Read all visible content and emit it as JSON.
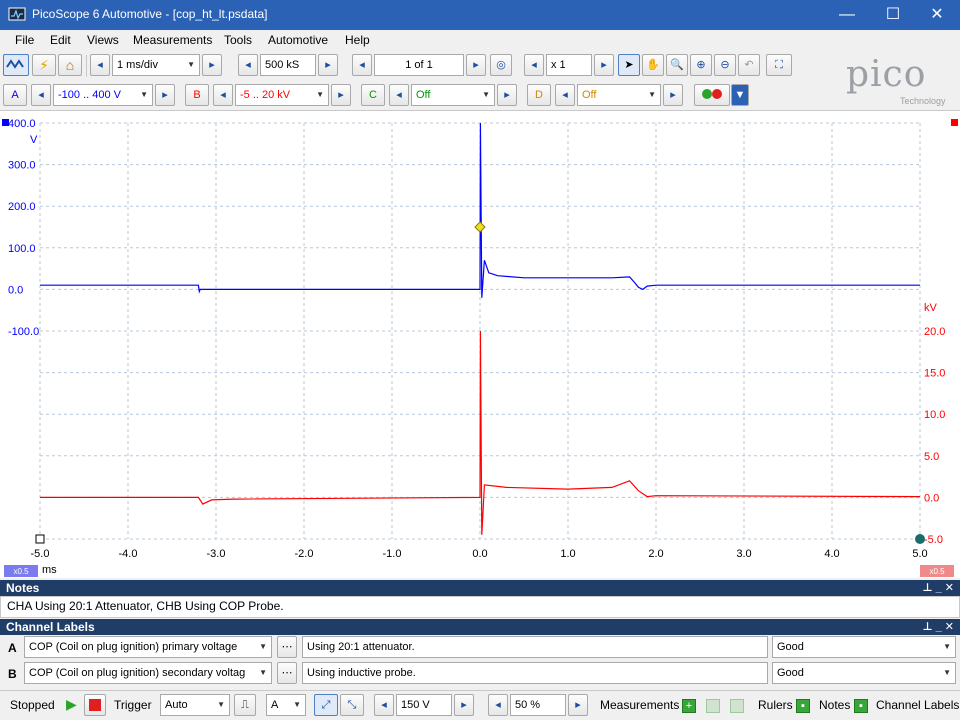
{
  "window": {
    "title": "PicoScope 6 Automotive - [cop_ht_lt.psdata]",
    "minimize": "—",
    "maximize": "☐",
    "close": "✕"
  },
  "menu": [
    "File",
    "Edit",
    "Views",
    "Measurements",
    "Tools",
    "Automotive",
    "Help"
  ],
  "toolbar": {
    "timebase": "1 ms/div",
    "samples": "500 kS",
    "buffer": "1 of 1",
    "zoom": "x 1"
  },
  "channels": {
    "a": {
      "letter": "A",
      "range": "-100 .. 400 V",
      "color": "#0000ff"
    },
    "b": {
      "letter": "B",
      "range": "-5 .. 20 kV",
      "color": "#ff0000"
    },
    "c": {
      "letter": "C",
      "range": "Off",
      "color": "#009900"
    },
    "d": {
      "letter": "D",
      "range": "Off",
      "color": "#cc8800"
    }
  },
  "logo": {
    "brand": "pico",
    "sub": "Technology"
  },
  "scope": {
    "left_axis_unit": "V",
    "right_axis_unit": "kV",
    "x_unit": "ms",
    "left_zoom_badge": "x0.5",
    "right_zoom_badge": "x0.5"
  },
  "chart_data": {
    "type": "line",
    "x": [
      -5.0,
      -4.0,
      -3.0,
      -2.0,
      -1.0,
      0.0,
      1.0,
      2.0,
      3.0,
      4.0,
      5.0
    ],
    "x_tick_labels": [
      "-5.0",
      "-4.0",
      "-3.0",
      "-2.0",
      "-1.0",
      "0.0",
      "1.0",
      "2.0",
      "3.0",
      "4.0",
      "5.0"
    ],
    "xlim": [
      -5.0,
      5.0
    ],
    "y_left_tick_labels": [
      "400.0",
      "300.0",
      "200.0",
      "100.0",
      "0.0",
      "-100.0"
    ],
    "ylim_left": [
      -100,
      400
    ],
    "y_right_tick_labels": [
      "20.0",
      "15.0",
      "10.0",
      "5.0",
      "0.0",
      "-5.0"
    ],
    "ylim_right": [
      -5,
      20
    ],
    "grid": true,
    "series": [
      {
        "color": "#0000ff",
        "axis": "left",
        "points": [
          [
            -5.0,
            10
          ],
          [
            -3.2,
            10
          ],
          [
            -3.19,
            -5
          ],
          [
            -3.18,
            0
          ],
          [
            0.0,
            0
          ],
          [
            0.005,
            400
          ],
          [
            0.02,
            -20
          ],
          [
            0.05,
            70
          ],
          [
            0.1,
            40
          ],
          [
            0.2,
            33
          ],
          [
            0.5,
            28
          ],
          [
            1.0,
            28
          ],
          [
            1.5,
            28
          ],
          [
            1.7,
            30
          ],
          [
            1.75,
            18
          ],
          [
            1.8,
            5
          ],
          [
            1.85,
            0
          ],
          [
            1.9,
            8
          ],
          [
            2.0,
            10
          ],
          [
            5.0,
            10
          ]
        ]
      },
      {
        "color": "#ff0000",
        "axis": "right",
        "points": [
          [
            -5.0,
            0
          ],
          [
            -3.2,
            0
          ],
          [
            -3.15,
            -0.8
          ],
          [
            -3.05,
            -0.3
          ],
          [
            -2.8,
            -0.2
          ],
          [
            0.0,
            0
          ],
          [
            0.005,
            20
          ],
          [
            0.02,
            -4.5
          ],
          [
            0.05,
            1.5
          ],
          [
            0.3,
            1.2
          ],
          [
            1.0,
            1.0
          ],
          [
            1.5,
            1.2
          ],
          [
            1.7,
            2.0
          ],
          [
            1.8,
            0.8
          ],
          [
            1.9,
            0.1
          ],
          [
            2.0,
            0.2
          ],
          [
            5.0,
            0.1
          ]
        ]
      }
    ],
    "trigger_marker": {
      "x": 0.0,
      "y": 150
    }
  },
  "notes": {
    "header": "Notes",
    "text": "CHA Using 20:1 Attenuator, CHB Using COP Probe."
  },
  "channel_labels": {
    "header": "Channel Labels",
    "rows": [
      {
        "ch": "A",
        "label": "COP (Coil on plug ignition) primary voltage",
        "note": "Using 20:1 attenuator.",
        "status": "Good"
      },
      {
        "ch": "B",
        "label": "COP (Coil on plug ignition) secondary voltag",
        "note": "Using inductive probe.",
        "status": "Good"
      }
    ]
  },
  "status": {
    "state": "Stopped",
    "trigger_label": "Trigger",
    "trigger_mode": "Auto",
    "trigger_channel": "A",
    "trigger_level": "150 V",
    "pretrigger": "50 %",
    "measurements": "Measurements",
    "rulers": "Rulers",
    "notes": "Notes",
    "channel_labels": "Channel Labels"
  }
}
